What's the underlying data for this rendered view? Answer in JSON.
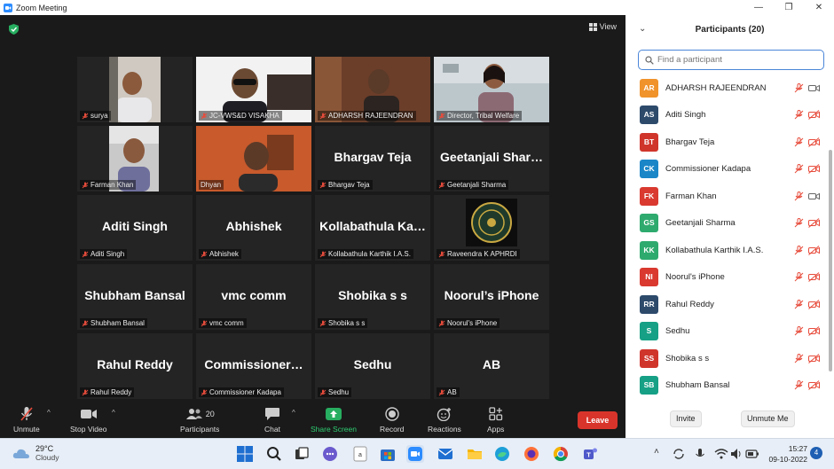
{
  "window": {
    "title": "Zoom Meeting"
  },
  "meeting": {
    "view_label": "View"
  },
  "tiles": [
    {
      "big": "",
      "name": "surya"
    },
    {
      "big": "",
      "name": "JC-VWS&D VISAKHA"
    },
    {
      "big": "",
      "name": "ADHARSH RAJEENDRAN"
    },
    {
      "big": "",
      "name": "Director, Tribal Welfare"
    },
    {
      "big": "",
      "name": "Farman Khan"
    },
    {
      "big": "",
      "name": "Dhyan"
    },
    {
      "big": "Bhargav Teja",
      "name": "Bhargav Teja"
    },
    {
      "big": "Geetanjali  Shar…",
      "name": "Geetanjali Sharma"
    },
    {
      "big": "Aditi Singh",
      "name": "Aditi Singh"
    },
    {
      "big": "Abhishek",
      "name": "Abhishek"
    },
    {
      "big": "Kollabathula  Ka…",
      "name": "Kollabathula Karthik I.A.S."
    },
    {
      "big": "",
      "name": "Raveendra K APHRDI"
    },
    {
      "big": "Shubham Bansal",
      "name": "Shubham Bansal"
    },
    {
      "big": "vmc comm",
      "name": "vmc comm"
    },
    {
      "big": "Shobika s s",
      "name": "Shobika s s"
    },
    {
      "big": "Noorul’s iPhone",
      "name": "Noorul's iPhone"
    },
    {
      "big": "Rahul Reddy",
      "name": "Rahul Reddy"
    },
    {
      "big": "Commissioner…",
      "name": "Commissioner Kadapa"
    },
    {
      "big": "Sedhu",
      "name": "Sedhu"
    },
    {
      "big": "AB",
      "name": "AB"
    }
  ],
  "toolbar": {
    "unmute": "Unmute",
    "stop_video": "Stop Video",
    "participants": "Participants",
    "participants_count": "20",
    "chat": "Chat",
    "share_screen": "Share Screen",
    "record": "Record",
    "reactions": "Reactions",
    "apps": "Apps",
    "leave": "Leave"
  },
  "panel": {
    "title": "Participants (20)",
    "search_placeholder": "Find a participant",
    "invite": "Invite",
    "unmute_me": "Unmute Me",
    "participants": [
      {
        "initials": "AR",
        "name": "ADHARSH RAJEENDRAN",
        "color": "#f0932b",
        "video": "on"
      },
      {
        "initials": "AS",
        "name": "Aditi Singh",
        "color": "#2d4a6b",
        "video": "off"
      },
      {
        "initials": "BT",
        "name": "Bhargav Teja",
        "color": "#d0352b",
        "video": "off"
      },
      {
        "initials": "CK",
        "name": "Commissioner Kadapa",
        "color": "#1a86c8",
        "video": "off"
      },
      {
        "initials": "FK",
        "name": "Farman Khan",
        "color": "#d9392f",
        "video": "on"
      },
      {
        "initials": "GS",
        "name": "Geetanjali Sharma",
        "color": "#2eaa6e",
        "video": "off"
      },
      {
        "initials": "KK",
        "name": "Kollabathula Karthik I.A.S.",
        "color": "#2eaa6e",
        "video": "off"
      },
      {
        "initials": "NI",
        "name": "Noorul's iPhone",
        "color": "#d9392f",
        "video": "off"
      },
      {
        "initials": "RR",
        "name": "Rahul Reddy",
        "color": "#2d4a6b",
        "video": "off"
      },
      {
        "initials": "S",
        "name": "Sedhu",
        "color": "#16a085",
        "video": "off"
      },
      {
        "initials": "SS",
        "name": "Shobika s s",
        "color": "#d0352b",
        "video": "off"
      },
      {
        "initials": "SB",
        "name": "Shubham Bansal",
        "color": "#16a085",
        "video": "off"
      }
    ]
  },
  "taskbar": {
    "temperature": "29°C",
    "weather": "Cloudy",
    "time": "15:27",
    "date": "09-10-2022",
    "notifications": "4"
  }
}
